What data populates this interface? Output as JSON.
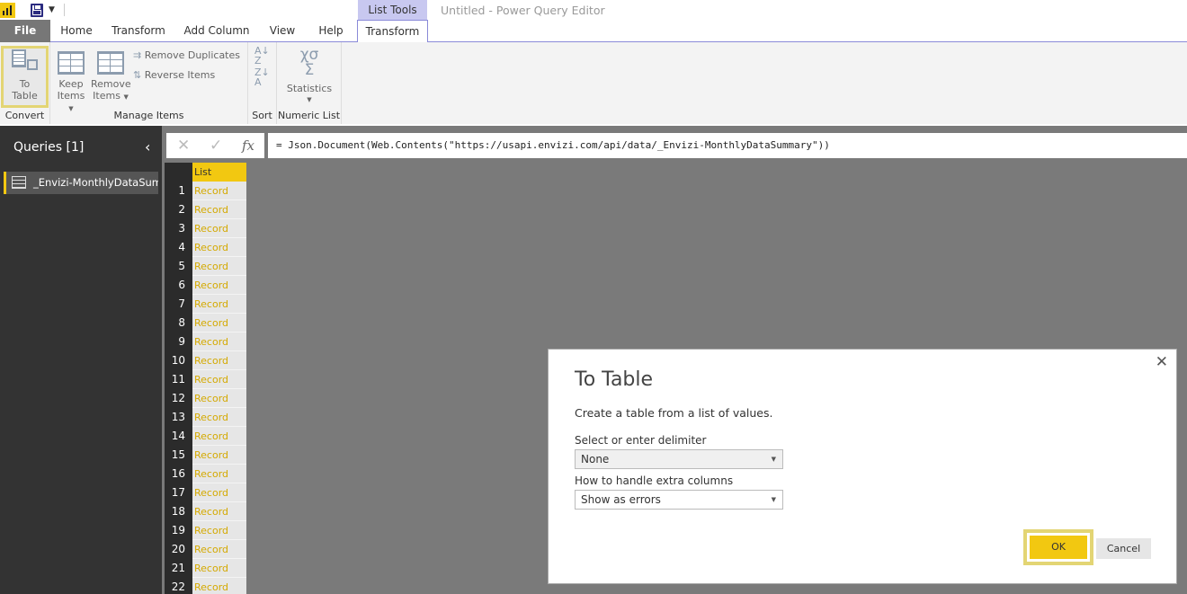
{
  "titlebar": {
    "context_group": "List Tools",
    "window_title": "Untitled - Power Query Editor"
  },
  "tabs": [
    {
      "label": "File"
    },
    {
      "label": "Home"
    },
    {
      "label": "Transform"
    },
    {
      "label": "Add Column"
    },
    {
      "label": "View"
    },
    {
      "label": "Help"
    },
    {
      "label": "Transform"
    }
  ],
  "ribbon": {
    "convert": {
      "label": "Convert",
      "to_table_line1": "To",
      "to_table_line2": "Table"
    },
    "manage_items": {
      "label": "Manage Items",
      "keep_line1": "Keep",
      "keep_line2": "Items",
      "remove_line1": "Remove",
      "remove_line2": "Items",
      "remove_duplicates": "Remove Duplicates",
      "reverse_items": "Reverse Items"
    },
    "sort": {
      "label": "Sort"
    },
    "numeric_list": {
      "label": "Numeric List",
      "statistics": "Statistics"
    }
  },
  "queries": {
    "title": "Queries [1]",
    "items": [
      {
        "label": "_Envizi-MonthlyDataSum..."
      }
    ]
  },
  "formula_bar": {
    "formula": "= Json.Document(Web.Contents(\"https://usapi.envizi.com/api/data/_Envizi-MonthlyDataSummary\"))"
  },
  "grid": {
    "column_header": "List",
    "rows": [
      {
        "n": "1",
        "v": "Record"
      },
      {
        "n": "2",
        "v": "Record"
      },
      {
        "n": "3",
        "v": "Record"
      },
      {
        "n": "4",
        "v": "Record"
      },
      {
        "n": "5",
        "v": "Record"
      },
      {
        "n": "6",
        "v": "Record"
      },
      {
        "n": "7",
        "v": "Record"
      },
      {
        "n": "8",
        "v": "Record"
      },
      {
        "n": "9",
        "v": "Record"
      },
      {
        "n": "10",
        "v": "Record"
      },
      {
        "n": "11",
        "v": "Record"
      },
      {
        "n": "12",
        "v": "Record"
      },
      {
        "n": "13",
        "v": "Record"
      },
      {
        "n": "14",
        "v": "Record"
      },
      {
        "n": "15",
        "v": "Record"
      },
      {
        "n": "16",
        "v": "Record"
      },
      {
        "n": "17",
        "v": "Record"
      },
      {
        "n": "18",
        "v": "Record"
      },
      {
        "n": "19",
        "v": "Record"
      },
      {
        "n": "20",
        "v": "Record"
      },
      {
        "n": "21",
        "v": "Record"
      },
      {
        "n": "22",
        "v": "Record"
      }
    ]
  },
  "dialog": {
    "title": "To Table",
    "description": "Create a table from a list of values.",
    "delimiter_label": "Select or enter delimiter",
    "delimiter_value": "None",
    "extra_columns_label": "How to handle extra columns",
    "extra_columns_value": "Show as errors",
    "ok_label": "OK",
    "cancel_label": "Cancel"
  },
  "colors": {
    "accent_yellow": "#f2c811",
    "highlight_border": "#e3d574",
    "pane_dark": "#333333",
    "context_tab": "#c8c8f0"
  }
}
